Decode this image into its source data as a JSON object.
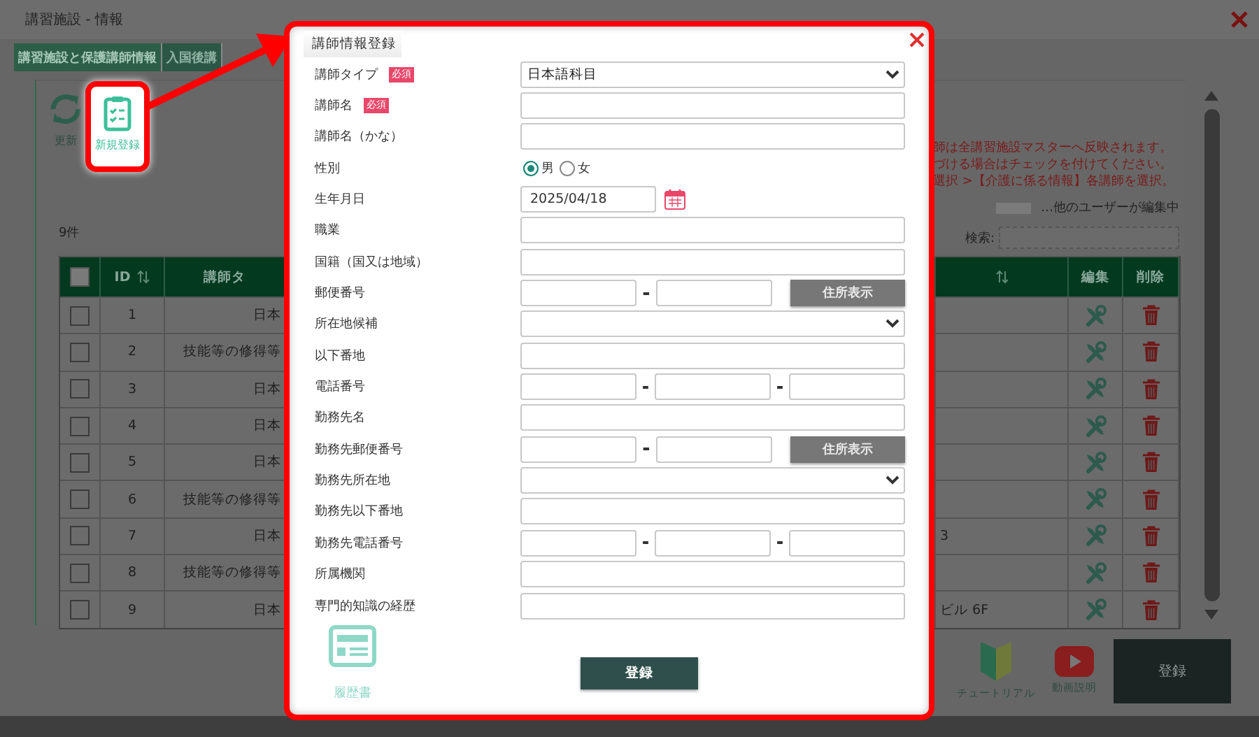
{
  "window": {
    "title": "講習施設 - 情報"
  },
  "tabs": [
    {
      "label": "講習施設と保護講師情報",
      "selected": true
    },
    {
      "label": "入国後講",
      "selected": false
    }
  ],
  "toolbar": [
    {
      "kind": "refresh",
      "label": "更新",
      "highlighted": false
    },
    {
      "kind": "new",
      "label": "新規登録",
      "highlighted": true
    }
  ],
  "notice": [
    "師は全講習施設マスターへ反映されます。",
    "づける場合はチェックを付けてください。",
    "選択 >【介護に係る情報】各講師を選択。"
  ],
  "legend": "…他のユーザーが編集中",
  "search": {
    "label": "検索:"
  },
  "count": "9件",
  "table": {
    "header_checked": false,
    "columns": [
      {
        "kind": "check"
      },
      {
        "kind": "text",
        "label": "ID",
        "sortable": true
      },
      {
        "kind": "text",
        "label": "講師タ",
        "sortable": false
      },
      {
        "kind": "hidden"
      },
      {
        "kind": "text",
        "sortable": true
      },
      {
        "kind": "text",
        "label": "編集",
        "sortable": false
      },
      {
        "kind": "text",
        "label": "削除",
        "sortable": false
      }
    ],
    "rows": [
      {
        "checked": false,
        "id": "1",
        "type": "日本"
      },
      {
        "checked": false,
        "id": "2",
        "type": "技能等の修得等"
      },
      {
        "checked": false,
        "id": "3",
        "type": "日本"
      },
      {
        "checked": false,
        "id": "4",
        "type": "日本"
      },
      {
        "checked": false,
        "id": "5",
        "type": "日本"
      },
      {
        "checked": false,
        "id": "6",
        "type": "技能等の修得等"
      },
      {
        "checked": false,
        "id": "7",
        "type": "日本",
        "extra": "3"
      },
      {
        "checked": false,
        "id": "8",
        "type": "技能等の修得等"
      },
      {
        "checked": false,
        "id": "9",
        "type": "日本",
        "extra": "ビル 6F"
      }
    ]
  },
  "modal": {
    "title": "講師情報登録",
    "fields": [
      {
        "label": "講師タイプ",
        "badge": "必須",
        "kind": "select",
        "value": "日本語科目"
      },
      {
        "label": "講師名",
        "badge": "必須",
        "kind": "text"
      },
      {
        "label": "講師名（かな）",
        "kind": "text"
      },
      {
        "label": "性別",
        "kind": "radio",
        "options": [
          {
            "label": "男",
            "selected": true
          },
          {
            "label": "女",
            "selected": false
          }
        ]
      },
      {
        "label": "生年月日",
        "kind": "date",
        "value": "2025/04/18"
      },
      {
        "label": "職業",
        "kind": "text"
      },
      {
        "label": "国籍（国又は地域）",
        "kind": "text"
      },
      {
        "label": "郵便番号",
        "kind": "zip",
        "button": "住所表示"
      },
      {
        "label": "所在地候補",
        "kind": "select"
      },
      {
        "label": "以下番地",
        "kind": "text"
      },
      {
        "label": "電話番号",
        "kind": "tel"
      },
      {
        "label": "勤務先名",
        "kind": "text"
      },
      {
        "label": "勤務先郵便番号",
        "kind": "zip",
        "button": "住所表示"
      },
      {
        "label": "勤務先所在地",
        "kind": "select"
      },
      {
        "label": "勤務先以下番地",
        "kind": "text"
      },
      {
        "label": "勤務先電話番号",
        "kind": "tel"
      },
      {
        "label": "所属機関",
        "kind": "text"
      },
      {
        "label": "専門的知識の経歴",
        "kind": "text"
      }
    ],
    "resume_label": "履歴書",
    "submit": "登録"
  },
  "footer": {
    "tutorial": "チュートリアル",
    "video": "動画説明",
    "submit": "登録"
  }
}
